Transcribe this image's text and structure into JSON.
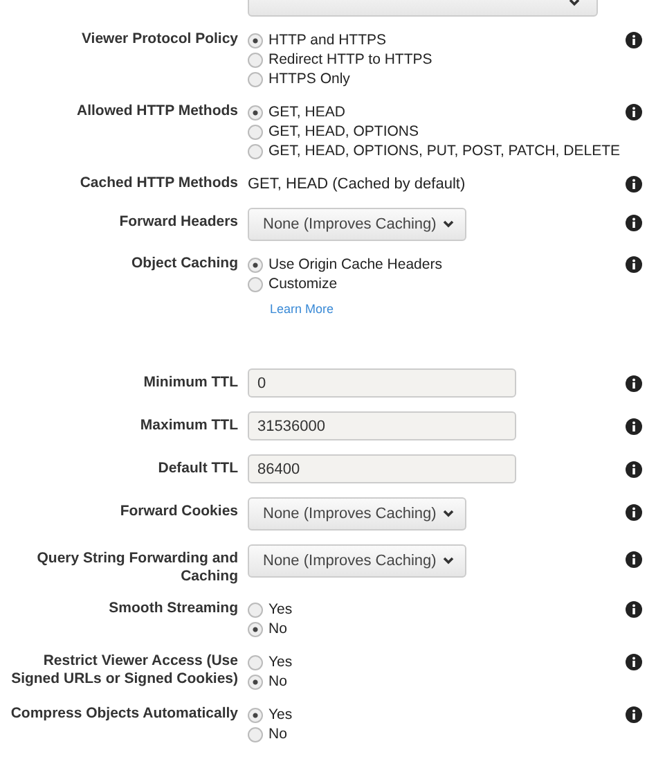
{
  "rows": [
    {
      "kind": "topselect",
      "label": "",
      "value": ""
    },
    {
      "kind": "radio",
      "label": "Viewer Protocol Policy",
      "options": [
        {
          "label": "HTTP and HTTPS",
          "selected": true
        },
        {
          "label": "Redirect HTTP to HTTPS",
          "selected": false
        },
        {
          "label": "HTTPS Only",
          "selected": false
        }
      ]
    },
    {
      "kind": "radio",
      "label": "Allowed HTTP Methods",
      "options": [
        {
          "label": "GET, HEAD",
          "selected": true
        },
        {
          "label": "GET, HEAD, OPTIONS",
          "selected": false
        },
        {
          "label": "GET, HEAD, OPTIONS, PUT, POST, PATCH, DELETE",
          "selected": false
        }
      ]
    },
    {
      "kind": "text",
      "label": "Cached HTTP Methods",
      "value": "GET, HEAD (Cached by default)"
    },
    {
      "kind": "select",
      "label": "Forward Headers",
      "value": "None (Improves Caching)"
    },
    {
      "kind": "radio",
      "label": "Object Caching",
      "options": [
        {
          "label": "Use Origin Cache Headers",
          "selected": true
        },
        {
          "label": "Customize",
          "selected": false
        }
      ],
      "link": "Learn More"
    },
    {
      "kind": "input",
      "label": "Minimum TTL",
      "value": "0"
    },
    {
      "kind": "input",
      "label": "Maximum TTL",
      "value": "31536000"
    },
    {
      "kind": "input",
      "label": "Default TTL",
      "value": "86400"
    },
    {
      "kind": "select",
      "label": "Forward Cookies",
      "value": "None (Improves Caching)"
    },
    {
      "kind": "select",
      "label": "Query String Forwarding and Caching",
      "value": "None (Improves Caching)"
    },
    {
      "kind": "radio",
      "label": "Smooth Streaming",
      "options": [
        {
          "label": "Yes",
          "selected": false
        },
        {
          "label": "No",
          "selected": true
        }
      ]
    },
    {
      "kind": "radio",
      "label": "Restrict Viewer Access (Use Signed URLs or Signed Cookies)",
      "options": [
        {
          "label": "Yes",
          "selected": false
        },
        {
          "label": "No",
          "selected": true
        }
      ]
    },
    {
      "kind": "radio",
      "label": "Compress Objects Automatically",
      "options": [
        {
          "label": "Yes",
          "selected": true
        },
        {
          "label": "No",
          "selected": false
        }
      ]
    }
  ]
}
